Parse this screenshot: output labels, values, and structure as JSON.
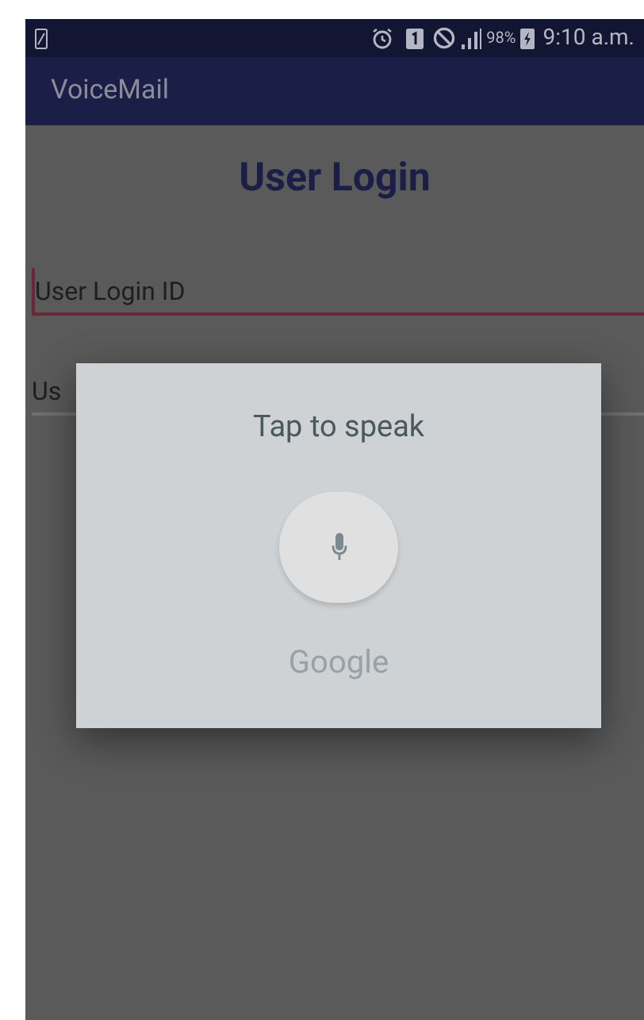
{
  "status_bar": {
    "battery": "98%",
    "time": "9:10 a.m."
  },
  "app_bar": {
    "title": "VoiceMail"
  },
  "login": {
    "title": "User Login",
    "fields": [
      {
        "placeholder": "User Login ID",
        "focused": true
      },
      {
        "placeholder": "Us",
        "focused": false
      }
    ]
  },
  "dialog": {
    "prompt": "Tap to speak",
    "brand": "Google"
  }
}
